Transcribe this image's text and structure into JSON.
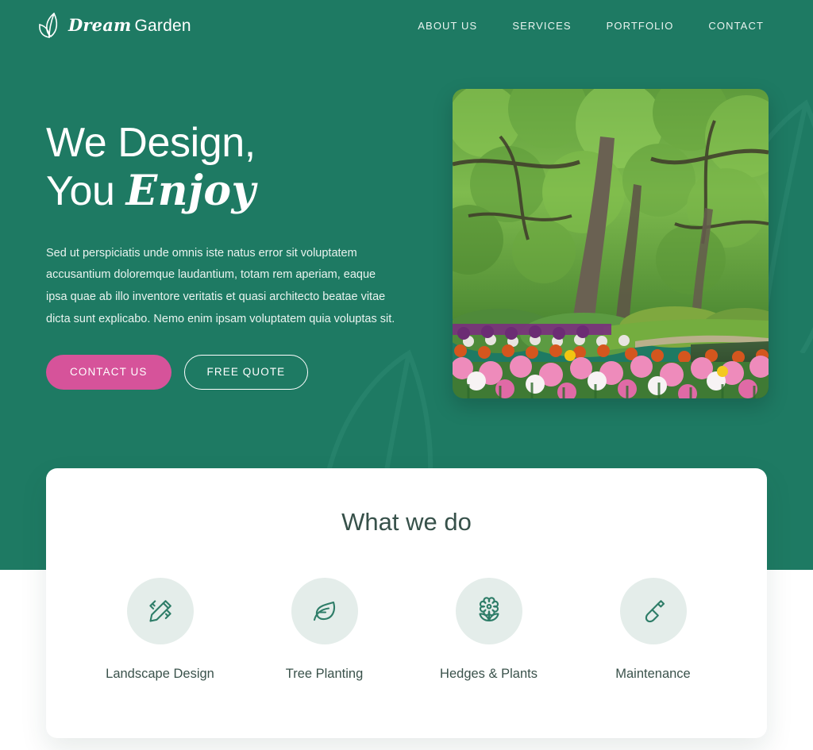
{
  "theme": {
    "green": "#1E7A63",
    "pink": "#D6539A",
    "card_bg": "#FFFFFF",
    "icon_circle": "#E4EDEA",
    "text_dark": "#37514A",
    "text_light": "#E9F3EF"
  },
  "header": {
    "brand": {
      "dream": "Dream",
      "garden": "Garden",
      "icon": "leaf-logo-icon"
    },
    "nav": [
      {
        "label": "ABOUT US",
        "name": "nav-about-us"
      },
      {
        "label": "SERVICES",
        "name": "nav-services"
      },
      {
        "label": "PORTFOLIO",
        "name": "nav-portfolio"
      },
      {
        "label": "CONTACT",
        "name": "nav-contact"
      }
    ]
  },
  "hero": {
    "headline_line1": "We Design,",
    "headline_line2_plain": "You ",
    "headline_line2_script": "Enjoy",
    "paragraph": "Sed ut perspiciatis unde omnis iste natus error sit voluptatem accusantium doloremque laudantium, totam rem aperiam, eaque ipsa quae ab illo inventore veritatis et quasi architecto beatae vitae dicta sunt explicabo. Nemo enim ipsam voluptatem quia voluptas sit.",
    "primary_button": "CONTACT US",
    "secondary_button": "FREE QUOTE",
    "image_alt": "garden-landscape-photo"
  },
  "services": {
    "title": "What we do",
    "items": [
      {
        "label": "Landscape Design",
        "icon": "pencil-ruler-icon"
      },
      {
        "label": "Tree Planting",
        "icon": "leaf-icon"
      },
      {
        "label": "Hedges & Plants",
        "icon": "flower-icon"
      },
      {
        "label": "Maintenance",
        "icon": "shovel-icon"
      }
    ]
  },
  "decor": {
    "watermark_left": "leaf-watermark-icon",
    "watermark_right": "leaf-watermark-icon"
  }
}
